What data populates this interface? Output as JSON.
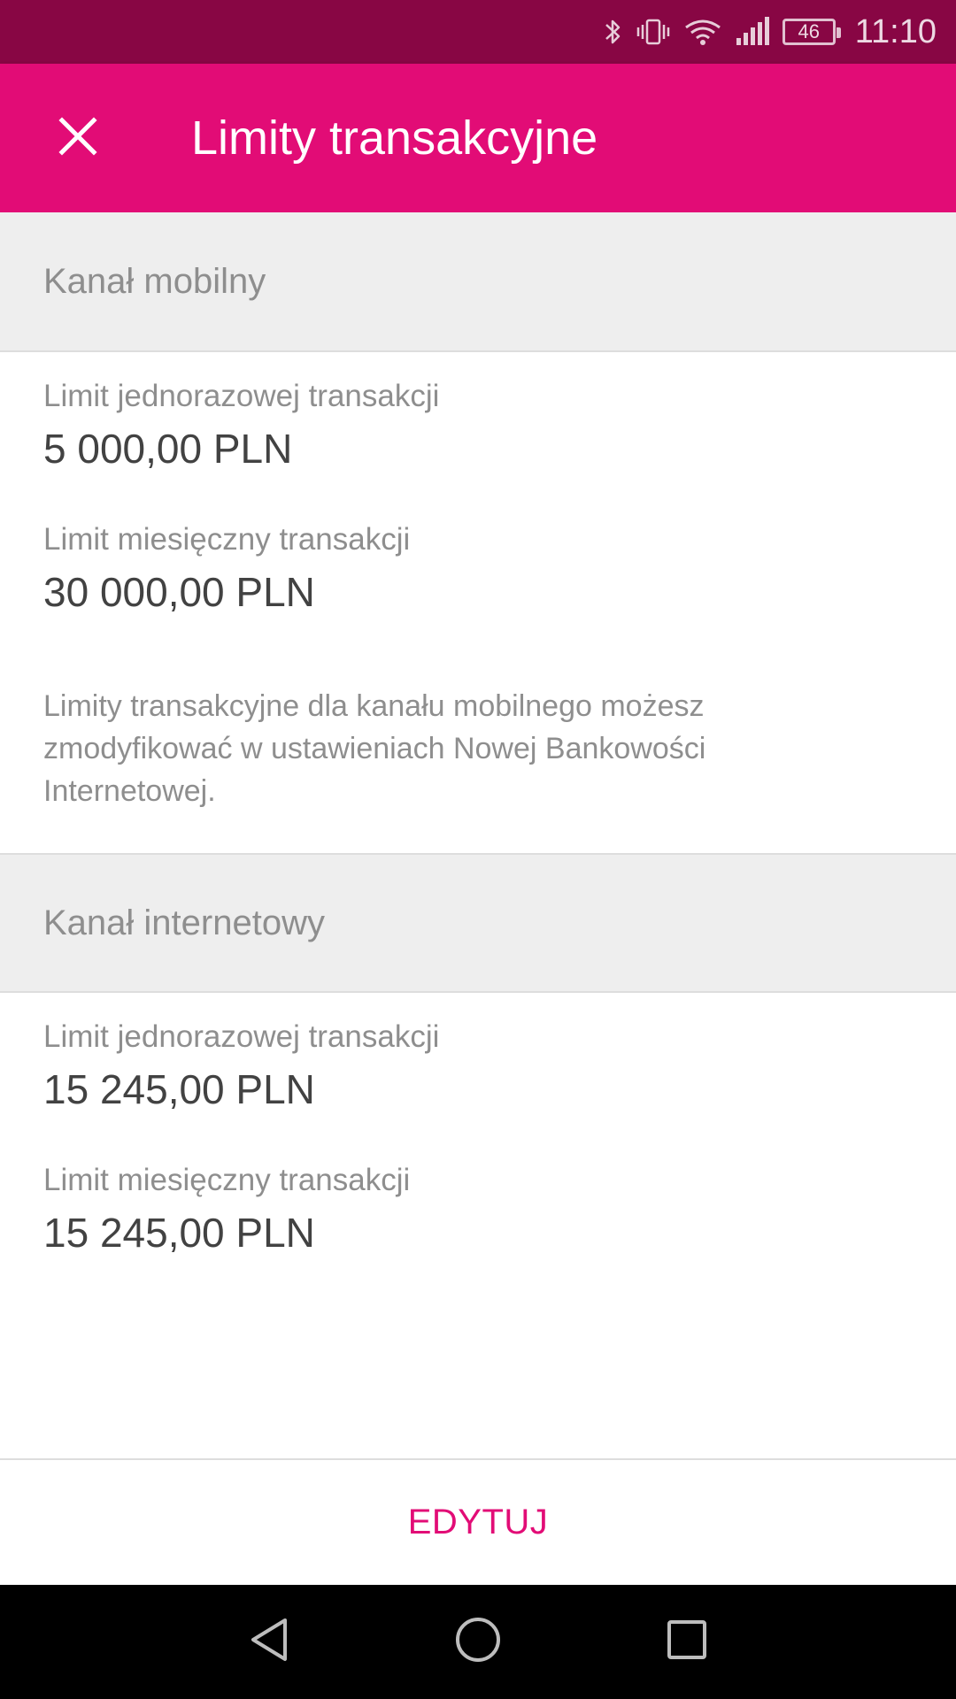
{
  "status_bar": {
    "time": "11:10",
    "battery_level": "46",
    "icons": [
      "bluetooth-icon",
      "vibrate-icon",
      "wifi-icon",
      "signal-icon",
      "battery-icon"
    ]
  },
  "app_bar": {
    "title": "Limity transakcyjne",
    "close_icon": "close-icon"
  },
  "sections": {
    "mobile": {
      "title": "Kanał mobilny",
      "single_limit_label": "Limit jednorazowej transakcji",
      "single_limit_value": "5 000,00 PLN",
      "monthly_limit_label": "Limit miesięczny transakcji",
      "monthly_limit_value": "30 000,00 PLN",
      "info": "Limity transakcyjne dla kanału mobilnego możesz zmodyfikować w ustawieniach Nowej Bankowości Internetowej."
    },
    "internet": {
      "title": "Kanał internetowy",
      "single_limit_label": "Limit jednorazowej transakcji",
      "single_limit_value": "15 245,00 PLN",
      "monthly_limit_label": "Limit miesięczny transakcji",
      "monthly_limit_value": "15 245,00 PLN"
    }
  },
  "actions": {
    "edit_label": "EDYTUJ"
  },
  "nav_bar": {
    "icons": [
      "back-icon",
      "home-icon",
      "recents-icon"
    ]
  },
  "colors": {
    "status_bar": "#880644",
    "app_bar": "#e20c76",
    "accent": "#e20c76",
    "section_background": "#eeeeee"
  }
}
